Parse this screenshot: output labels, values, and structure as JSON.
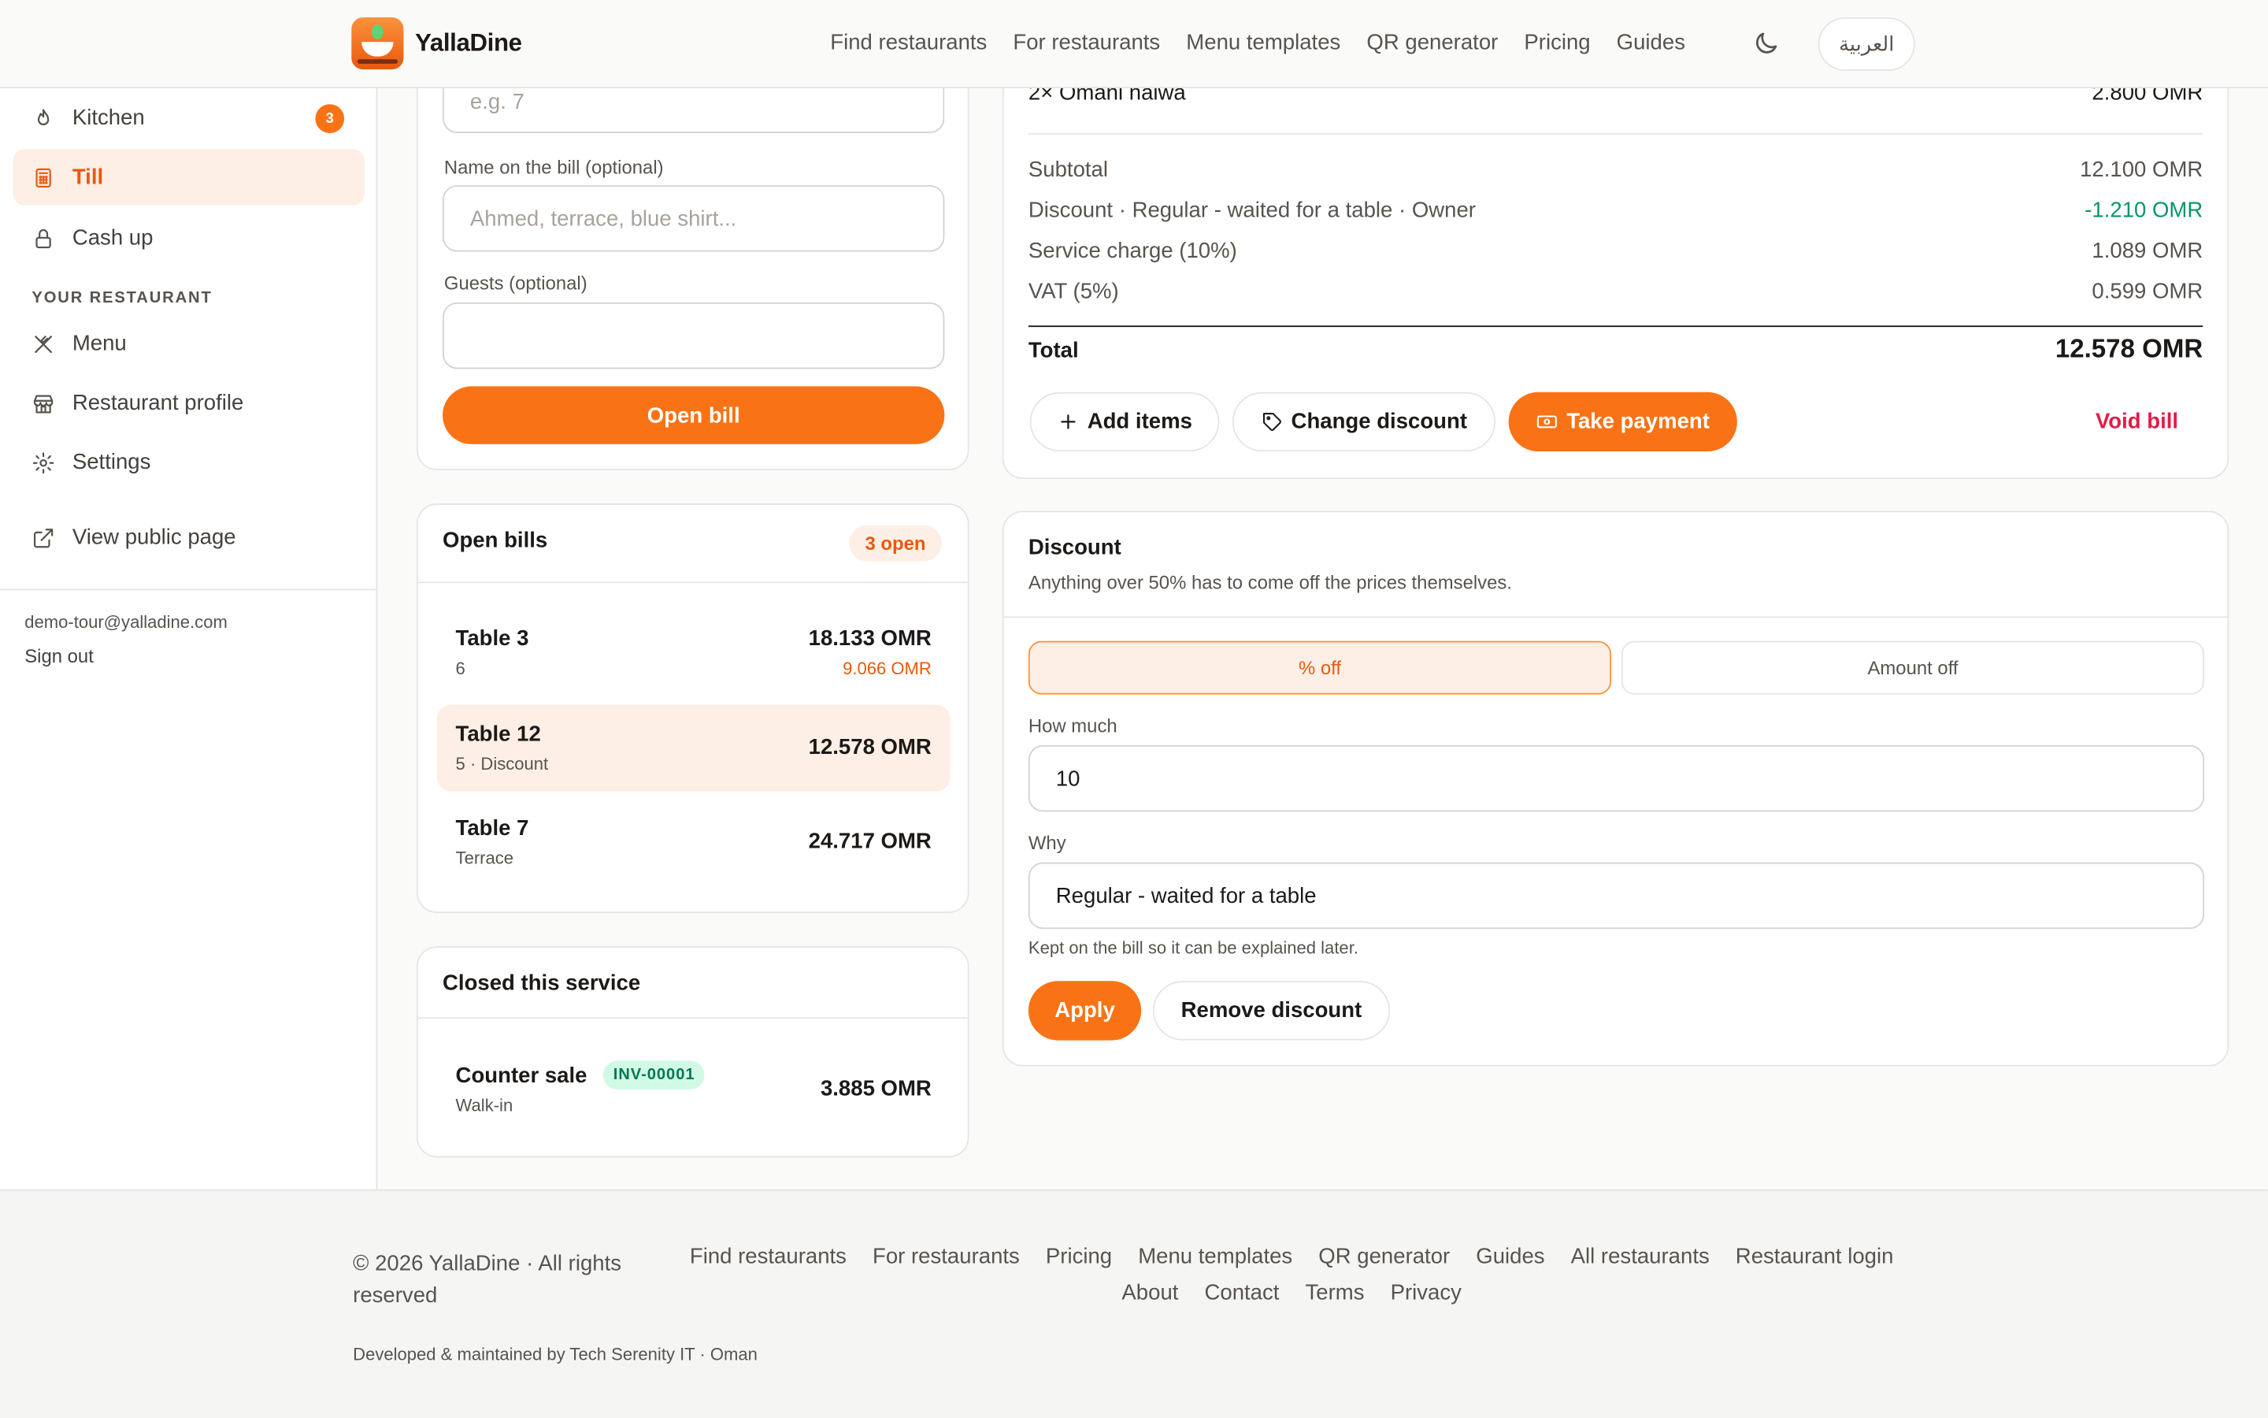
{
  "brand": {
    "name": "YallaDine"
  },
  "nav": {
    "links": [
      "Find restaurants",
      "For restaurants",
      "Menu templates",
      "QR generator",
      "Pricing",
      "Guides"
    ],
    "language_button": "العربية"
  },
  "sidebar": {
    "items": [
      {
        "label": "Kitchen",
        "badge": "3",
        "icon": "flame-icon"
      },
      {
        "label": "Till",
        "icon": "calculator-icon",
        "active": true
      },
      {
        "label": "Cash up",
        "icon": "lock-icon"
      }
    ],
    "section_title": "YOUR RESTAURANT",
    "restaurant_items": [
      {
        "label": "Menu",
        "icon": "utensils-icon"
      },
      {
        "label": "Restaurant profile",
        "icon": "store-icon"
      },
      {
        "label": "Settings",
        "icon": "gear-icon"
      }
    ],
    "public_link": "View public page",
    "user_email": "demo-tour@yalladine.com",
    "sign_out": "Sign out"
  },
  "new_bill": {
    "table_placeholder": "e.g. 7",
    "name_label": "Name on the bill (optional)",
    "name_placeholder": "Ahmed, terrace, blue shirt...",
    "guests_label": "Guests (optional)",
    "guests_value": "",
    "open_button": "Open bill"
  },
  "open_bills": {
    "title": "Open bills",
    "count_badge": "3 open",
    "rows": [
      {
        "name": "Table 3",
        "sub": "6",
        "amount": "18.133 OMR",
        "secondary": "9.066 OMR"
      },
      {
        "name": "Table 12",
        "sub": "5 · Discount",
        "amount": "12.578 OMR",
        "active": true
      },
      {
        "name": "Table 7",
        "sub": "Terrace",
        "amount": "24.717 OMR"
      }
    ]
  },
  "closed": {
    "title": "Closed this service",
    "rows": [
      {
        "name": "Counter sale",
        "invoice": "INV-00001",
        "sub": "Walk-in",
        "amount": "3.885 OMR"
      }
    ]
  },
  "bill": {
    "last_item": {
      "label": "2× Omani halwa",
      "amount": "2.800 OMR"
    },
    "subtotal": {
      "label": "Subtotal",
      "value": "12.100 OMR"
    },
    "discount": {
      "label": "Discount · Regular - waited for a table · Owner",
      "value": "-1.210 OMR"
    },
    "service": {
      "label": "Service charge (10%)",
      "value": "1.089 OMR"
    },
    "vat": {
      "label": "VAT (5%)",
      "value": "0.599 OMR"
    },
    "total": {
      "label": "Total",
      "value": "12.578 OMR"
    },
    "actions": {
      "add_items": "Add items",
      "change_discount": "Change discount",
      "take_payment": "Take payment",
      "void": "Void bill"
    }
  },
  "discount_panel": {
    "title": "Discount",
    "subtitle": "Anything over 50% has to come off the prices themselves.",
    "mode_percent": "% off",
    "mode_amount": "Amount off",
    "how_much_label": "How much",
    "how_much_value": "10",
    "why_label": "Why",
    "why_value": "Regular - waited for a table",
    "hint": "Kept on the bill so it can be explained later.",
    "apply": "Apply",
    "remove": "Remove discount"
  },
  "footer": {
    "copyright": "© 2026 YallaDine · All rights reserved",
    "links": [
      "Find restaurants",
      "For restaurants",
      "Pricing",
      "Menu templates",
      "QR generator",
      "Guides",
      "All restaurants",
      "Restaurant login",
      "About",
      "Contact",
      "Terms",
      "Privacy"
    ],
    "developer": "Developed & maintained by Tech Serenity IT · Oman"
  },
  "colors": {
    "accent": "#f97316",
    "accent_soft": "#fdefe5",
    "positive": "#059669",
    "danger": "#e11d48"
  }
}
